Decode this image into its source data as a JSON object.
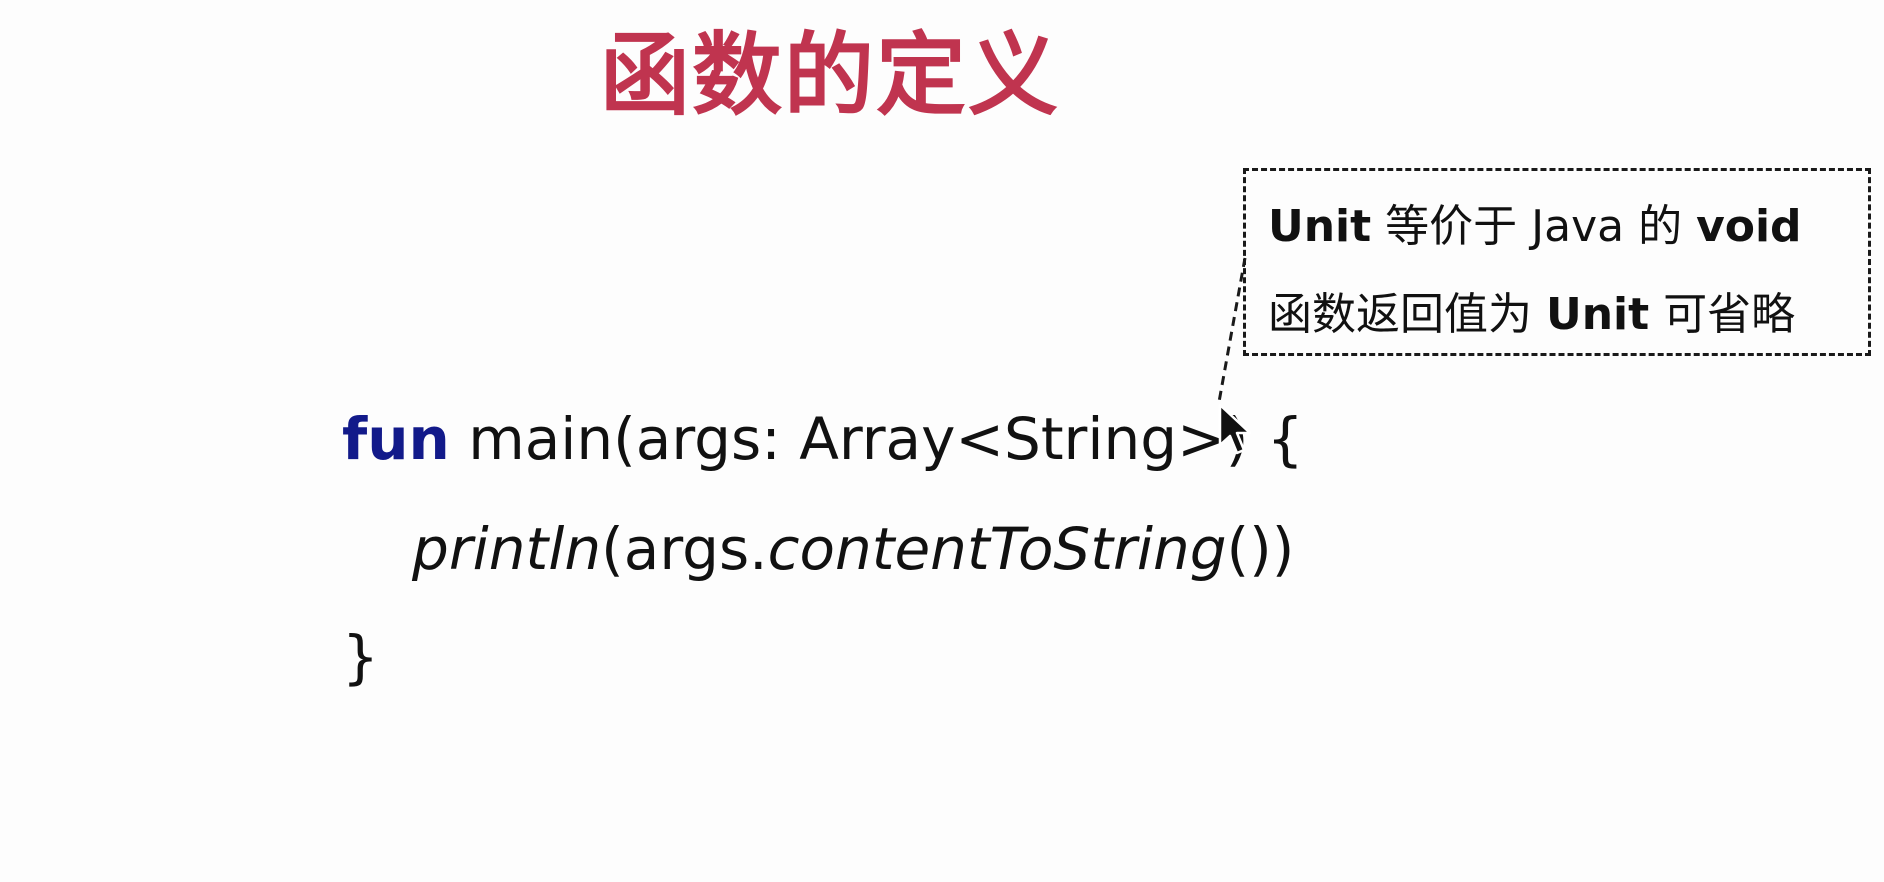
{
  "slide": {
    "title": "函数的定义"
  },
  "note": {
    "line1": {
      "keyword_unit": "Unit",
      "text_middle": " 等价于 Java 的 ",
      "keyword_void": "void"
    },
    "line2": {
      "text_start": "函数返回值为 ",
      "keyword_unit": "Unit",
      "text_end": " 可省略"
    }
  },
  "code": {
    "line1": {
      "keyword": "fun",
      "rest": " main(args: Array<String>) {"
    },
    "line2": {
      "fn": "println",
      "open": "(args.",
      "method": "contentToString",
      "close": "())"
    },
    "line3": {
      "text": "}"
    }
  },
  "colors": {
    "title": "#c0344f",
    "keyword": "#121a8a",
    "text": "#111111",
    "background": "#fdfdfd"
  },
  "icons": {
    "cursor": "mouse-pointer-icon"
  }
}
